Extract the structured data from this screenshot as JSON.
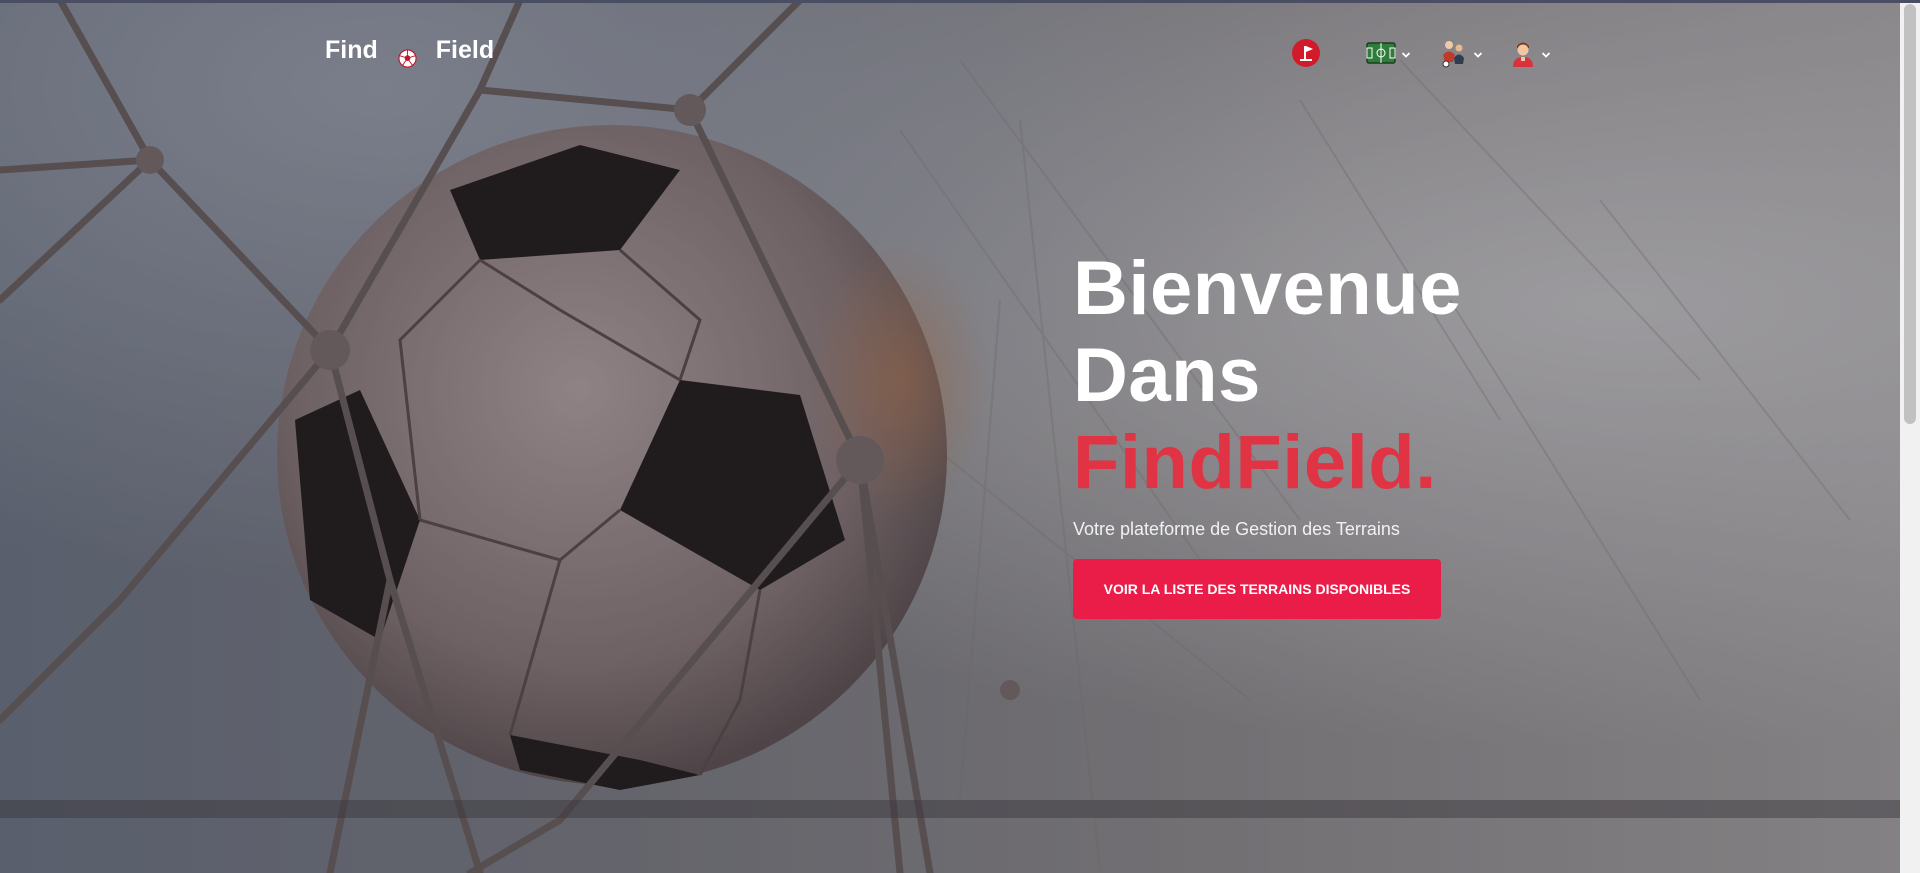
{
  "brand": {
    "word_left": "Find",
    "word_right": "Field",
    "icon": "soccer-ball-icon"
  },
  "nav": [
    {
      "name": "flag-icon",
      "has_dropdown": false
    },
    {
      "name": "pitch-icon",
      "has_dropdown": true
    },
    {
      "name": "players-icon",
      "has_dropdown": true
    },
    {
      "name": "user-avatar-icon",
      "has_dropdown": true
    }
  ],
  "hero": {
    "line1": "Bienvenue",
    "line2": "Dans",
    "line3": "FindField.",
    "tagline": "Votre plateforme de Gestion des Terrains",
    "cta_label": "VOIR LA LISTE DES TERRAINS DISPONIBLES"
  },
  "colors": {
    "accent": "#e03343",
    "button": "#ea1d48",
    "text": "#ffffff"
  }
}
